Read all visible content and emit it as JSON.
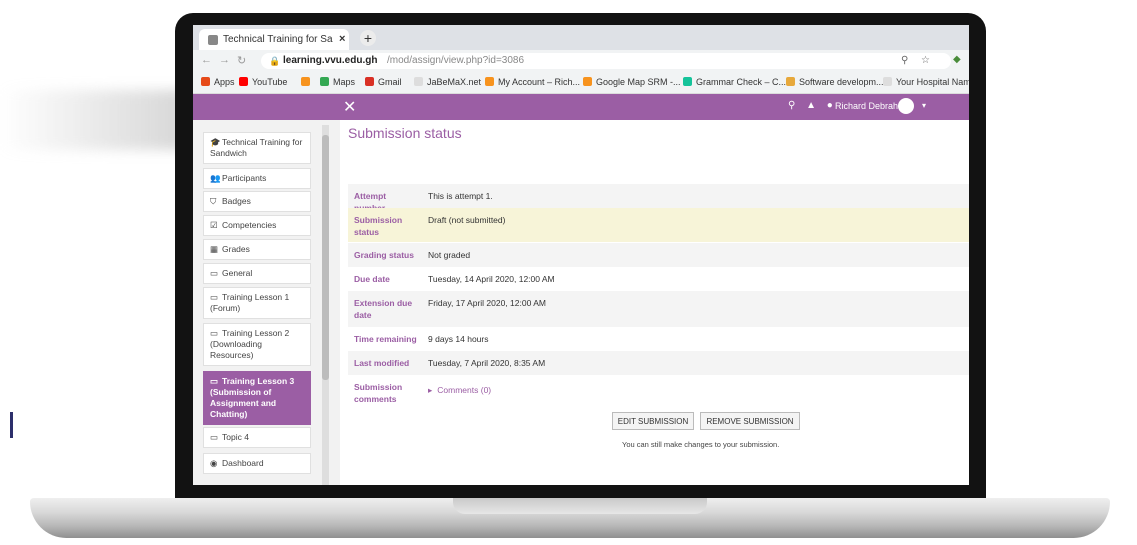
{
  "browser": {
    "tab_title": "Technical Training for Sandwich",
    "tab_close": "×",
    "new_tab": "+",
    "url_host": "learning.vvu.edu.gh",
    "url_path": "/mod/assign/view.php?id=3086",
    "bookmarks": [
      {
        "label": "Apps",
        "color": "#e64a19"
      },
      {
        "label": "YouTube",
        "color": "#ff0000"
      },
      {
        "label": "",
        "color": "#f7931e"
      },
      {
        "label": "Maps",
        "color": "#34a853"
      },
      {
        "label": "Gmail",
        "color": "#d93025"
      },
      {
        "label": "JaBeMaX.net",
        "color": "#dddddd"
      },
      {
        "label": "My Account – Rich...",
        "color": "#f7931e"
      },
      {
        "label": "Google Map SRM -...",
        "color": "#f7931e"
      },
      {
        "label": "Grammar Check – C...",
        "color": "#15c39a"
      },
      {
        "label": "Software developm...",
        "color": "#e7a83b"
      },
      {
        "label": "Your Hospital Name",
        "color": "#dddddd"
      }
    ]
  },
  "topnav": {
    "close_symbol": "✕",
    "search_icon": "⚲",
    "bell_icon": "▲",
    "chat_icon": "●",
    "user_name": "Richard Debrah",
    "caret": "▾"
  },
  "sidebar": {
    "items": [
      {
        "icon": "mortarboard-icon",
        "glyph": "🎓",
        "label": "Technical Training for Sandwich"
      },
      {
        "icon": "users-icon",
        "glyph": "👥",
        "label": "Participants"
      },
      {
        "icon": "shield-icon",
        "glyph": "⛉",
        "label": "Badges"
      },
      {
        "icon": "checkbox-icon",
        "glyph": "☑",
        "label": "Competencies"
      },
      {
        "icon": "table-icon",
        "glyph": "▦",
        "label": "Grades"
      },
      {
        "icon": "folder-icon",
        "glyph": "▭",
        "label": "General"
      },
      {
        "icon": "folder-icon",
        "glyph": "▭",
        "label": "Training Lesson 1 (Forum)"
      },
      {
        "icon": "folder-icon",
        "glyph": "▭",
        "label": "Training Lesson 2 (Downloading Resources)"
      },
      {
        "icon": "folder-icon",
        "glyph": "▭",
        "label": "Training Lesson 3 (Submission of Assignment and Chatting)"
      },
      {
        "icon": "folder-icon",
        "glyph": "▭",
        "label": "Topic 4"
      },
      {
        "icon": "dashboard-icon",
        "glyph": "◉",
        "label": "Dashboard"
      }
    ]
  },
  "main": {
    "heading": "Submission status",
    "rows": [
      {
        "label": "Attempt number",
        "value": "This is attempt 1."
      },
      {
        "label": "Submission status",
        "value": "Draft (not submitted)"
      },
      {
        "label": "Grading status",
        "value": "Not graded"
      },
      {
        "label": "Due date",
        "value": "Tuesday, 14 April 2020, 12:00 AM"
      },
      {
        "label": "Extension due date",
        "value": "Friday, 17 April 2020, 12:00 AM"
      },
      {
        "label": "Time remaining",
        "value": "9 days 14 hours"
      },
      {
        "label": "Last modified",
        "value": "Tuesday, 7 April 2020, 8:35 AM"
      },
      {
        "label": "Submission comments",
        "value": "Comments (0)"
      }
    ],
    "edit_button": "EDIT SUBMISSION",
    "remove_button": "REMOVE SUBMISSION",
    "note": "You can still make changes to your submission."
  }
}
